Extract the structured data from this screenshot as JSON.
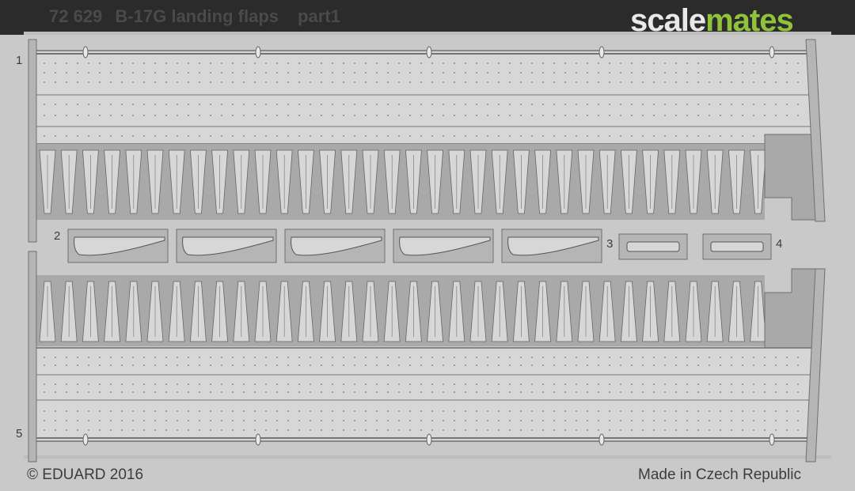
{
  "header": {
    "number": "72 629",
    "title": "B-17G landing flaps",
    "part": "part1"
  },
  "watermark": {
    "word_a": "scale",
    "word_b": "mates",
    "accent": "#8fc33a"
  },
  "part_numbers": {
    "p1": "1",
    "p2": "2",
    "p3": "3",
    "p4": "4",
    "p5": "5"
  },
  "footer": {
    "copyright": "© EDUARD 2016",
    "origin": "Made in Czech Republic"
  },
  "colors": {
    "metal": "#c9c9c9",
    "frame": "#dcdcdc",
    "dark_bg": "#2b2b2b"
  }
}
